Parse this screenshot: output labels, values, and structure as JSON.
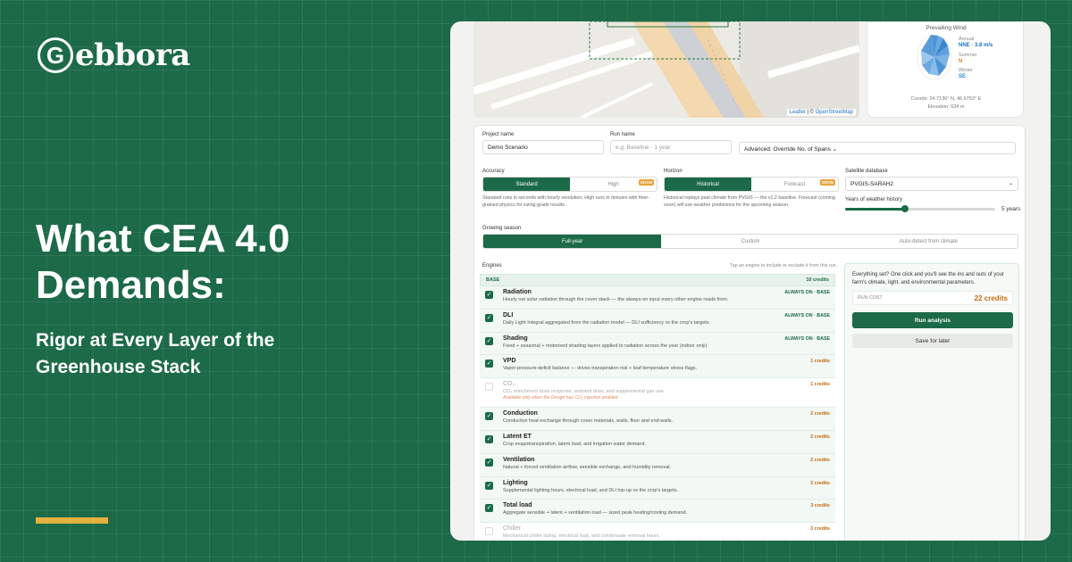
{
  "brand": {
    "mark": "G",
    "name": "ebbora"
  },
  "headline": "What CEA 4.0 Demands:",
  "subheadline": "Rigor at Every Layer of the Greenhouse Stack",
  "map": {
    "attribution_leaflet": "Leaflet",
    "attribution_sep": " | © ",
    "attribution_osm": "OpenStreetMap"
  },
  "wind": {
    "title": "Prevailing Wind",
    "annual_label": "Annual",
    "annual_value": "NNE · 3.8 m/s",
    "summer_label": "Summer",
    "summer_value": "N",
    "winter_label": "Winter",
    "winter_value": "SE",
    "coords": "Coords: 24.7136° N, 46.6753° E",
    "elevation": "Elevation: 634 m",
    "colors": {
      "annual": "#1f6fd0",
      "summer": "#e0892c",
      "winter": "#2a8fd0"
    }
  },
  "form": {
    "project_label": "Project name",
    "project_value": "Demo Scenario",
    "run_label": "Run name",
    "run_placeholder": "e.g. Baseline · 1 year",
    "advanced": "Advanced: Override No. of Spans",
    "accuracy_label": "Accuracy",
    "accuracy_options": [
      "Standard",
      "High"
    ],
    "accuracy_soon": "SOON",
    "accuracy_help": "Standard runs in seconds with hourly resolution; High runs in minutes with finer-grained physics for sizing-grade results.",
    "horizon_label": "Horizon",
    "horizon_options": [
      "Historical",
      "Forecast"
    ],
    "horizon_soon": "SOON",
    "horizon_help": "Historical replays past climate from PVGIS — the v1.2 baseline. Forecast (coming soon) will use weather predictions for the upcoming season.",
    "satellite_label": "Satellite database",
    "satellite_value": "PVGIS-SARAH2",
    "years_label": "Years of weather history",
    "years_value": "5 years",
    "years_fraction": 0.4,
    "season_label": "Growing season",
    "season_options": [
      "Full-year",
      "Custom",
      "Auto-detect from climate"
    ],
    "engines_label": "Engines",
    "engines_hint": "Tap an engine to include or exclude it from this run.",
    "base_label": "BASE",
    "base_credits": "10 credits"
  },
  "engines": [
    {
      "name": "Radiation",
      "desc": "Hourly net solar radiation through the cover stack — the always-on input every other engine reads from.",
      "credit": "ALWAYS ON · BASE",
      "checked": true
    },
    {
      "name": "DLI",
      "desc": "Daily Light Integral aggregated from the radiation model — DLI sufficiency vs the crop's targets.",
      "credit": "ALWAYS ON · BASE",
      "checked": true
    },
    {
      "name": "Shading",
      "desc": "Fixed + seasonal + motorised shading layers applied to radiation across the year (indoor only).",
      "credit": "ALWAYS ON · BASE",
      "checked": true
    },
    {
      "name": "VPD",
      "desc": "Vapor-pressure-deficit balance — drives transpiration risk + leaf-temperature stress flags.",
      "credit": "1 credits",
      "checked": true
    },
    {
      "name": "CO₂",
      "desc": "CO₂ enrichment dose response, ambient draw, and supplemental gas use.",
      "note": "Available only when the Design has CO₂ injection enabled",
      "credit": "1 credits",
      "checked": false
    },
    {
      "name": "Conduction",
      "desc": "Conductive heat exchange through cover materials, walls, floor and end-walls.",
      "credit": "2 credits",
      "checked": true
    },
    {
      "name": "Latent ET",
      "desc": "Crop evapotranspiration, latent load, and irrigation water demand.",
      "credit": "2 credits",
      "checked": true
    },
    {
      "name": "Ventilation",
      "desc": "Natural + forced ventilation airflow, sensible exchange, and humidity removal.",
      "credit": "2 credits",
      "checked": true
    },
    {
      "name": "Lighting",
      "desc": "Supplemental lighting hours, electrical load, and DLI top-up vs the crop's targets.",
      "credit": "2 credits",
      "checked": true
    },
    {
      "name": "Total load",
      "desc": "Aggregate sensible + latent + ventilation load — sized peak heating/cooling demand.",
      "credit": "3 credits",
      "checked": true
    },
    {
      "name": "Chiller",
      "desc": "Mechanical chiller sizing, electrical load, and condensate removal hours.",
      "credit": "3 credits",
      "checked": false
    }
  ],
  "summary": {
    "text": "Everything set? One click and you'll see the ins and outs of your farm's climate, light, and environmental parameters.",
    "cost_label": "RUN COST",
    "cost_value": "22 credits",
    "run_button": "Run analysis",
    "save_button": "Save for later"
  },
  "colors": {
    "brand_green": "#1c6a47",
    "accent": "#e3b13d",
    "credit": "#c06a10"
  }
}
